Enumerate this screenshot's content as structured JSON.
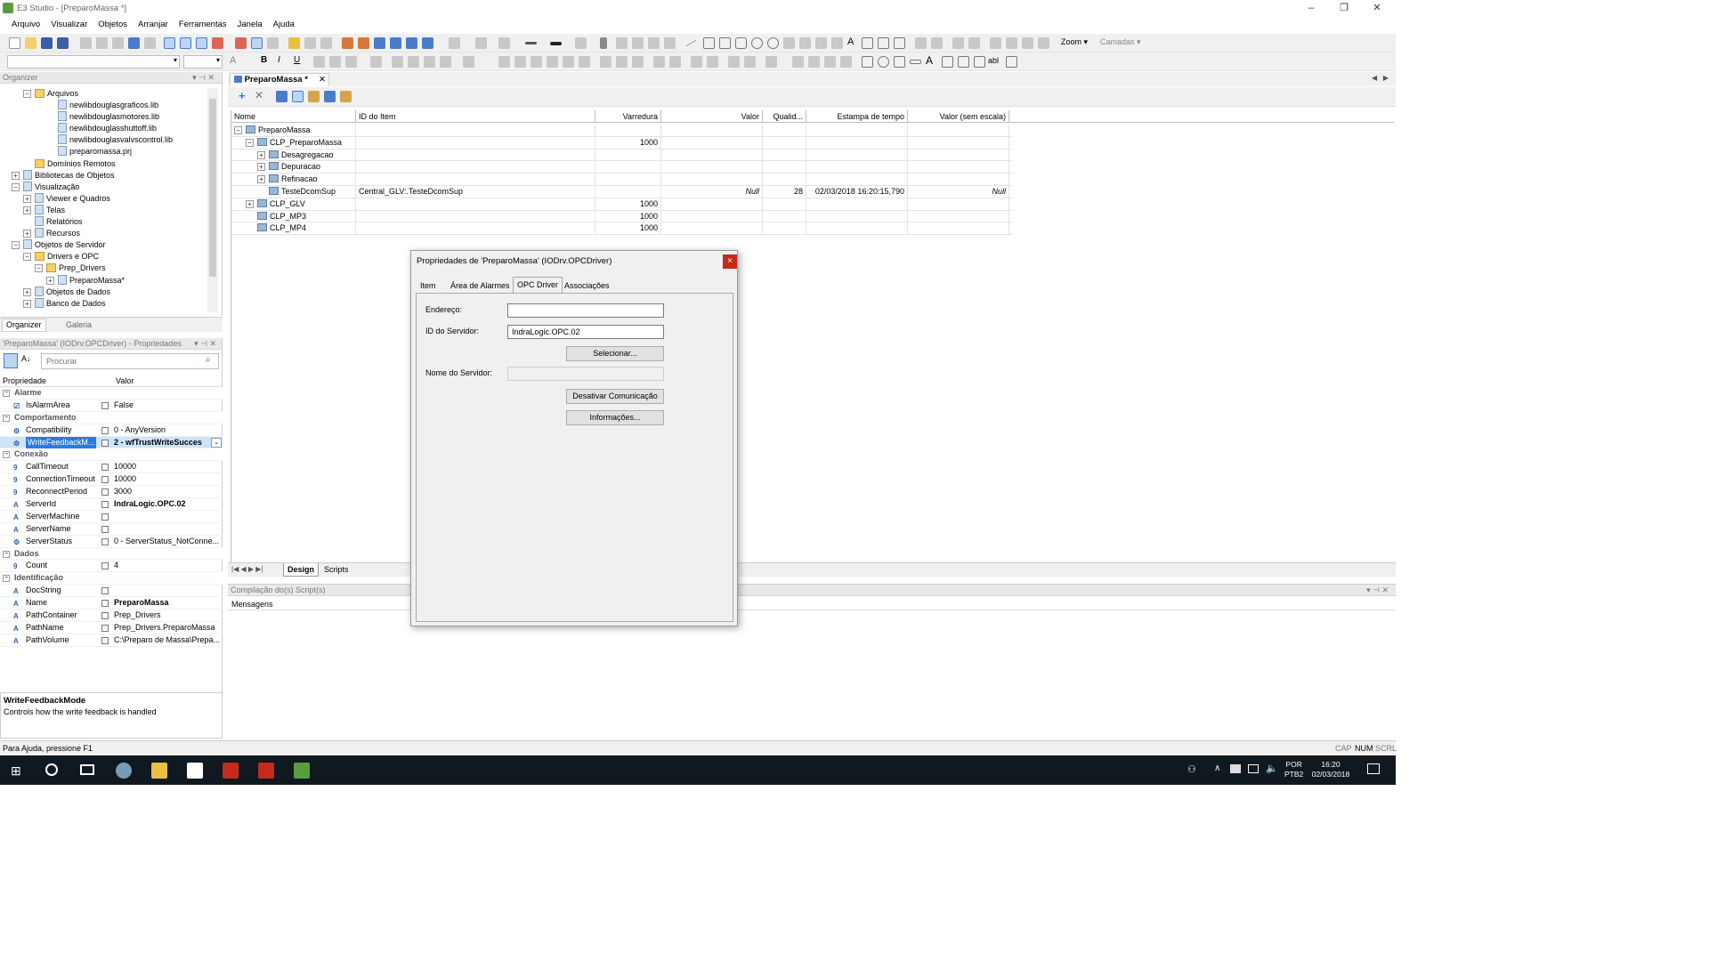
{
  "window": {
    "title": "E3 Studio - [PreparoMassa *]"
  },
  "menu": [
    "Arquivo",
    "Visualizar",
    "Objetos",
    "Arranjar",
    "Ferramentas",
    "Janela",
    "Ajuda"
  ],
  "toolbar": {
    "zoom_label": "Zoom",
    "layers_label": "Camadas"
  },
  "organizer": {
    "header": "Organizer",
    "tree": [
      {
        "label": "Arquivos",
        "indent": 3,
        "type": "folder",
        "exp": "-"
      },
      {
        "label": "newlibdouglasgraficos.lib",
        "indent": 5,
        "type": "file"
      },
      {
        "label": "newlibdouglasmotores.lib",
        "indent": 5,
        "type": "file"
      },
      {
        "label": "newlibdouglasshuttoff.lib",
        "indent": 5,
        "type": "file"
      },
      {
        "label": "newlibdouglasvalvscontrol.lib",
        "indent": 5,
        "type": "file"
      },
      {
        "label": "preparomassa.prj",
        "indent": 5,
        "type": "file"
      },
      {
        "label": "Domínios Remotos",
        "indent": 3,
        "type": "folder"
      },
      {
        "label": "Bibliotecas de Objetos",
        "indent": 2,
        "type": "file",
        "exp": "+"
      },
      {
        "label": "Visualização",
        "indent": 2,
        "type": "file",
        "exp": "-"
      },
      {
        "label": "Viewer e Quadros",
        "indent": 3,
        "type": "file",
        "exp": "+"
      },
      {
        "label": "Telas",
        "indent": 3,
        "type": "file",
        "exp": "+"
      },
      {
        "label": "Relatórios",
        "indent": 3,
        "type": "file"
      },
      {
        "label": "Recursos",
        "indent": 3,
        "type": "file",
        "exp": "+"
      },
      {
        "label": "Objetos de Servidor",
        "indent": 2,
        "type": "file",
        "exp": "-"
      },
      {
        "label": "Drivers e OPC",
        "indent": 3,
        "type": "folder",
        "exp": "-"
      },
      {
        "label": "Prep_Drivers",
        "indent": 4,
        "type": "folder",
        "exp": "-"
      },
      {
        "label": "PreparoMassa*",
        "indent": 5,
        "type": "file",
        "exp": "+"
      },
      {
        "label": "Objetos de Dados",
        "indent": 3,
        "type": "file",
        "exp": "+"
      },
      {
        "label": "Banco de Dados",
        "indent": 3,
        "type": "file",
        "exp": "+"
      }
    ],
    "tabs": [
      "Organizer",
      "Galeria"
    ]
  },
  "properties": {
    "header": "'PreparoMassa' (IODrv.OPCDriver) - Propriedades",
    "search_placeholder": "Procurar",
    "col_prop": "Propriedade",
    "col_value": "Valor",
    "rows": [
      {
        "cat": "Alarme"
      },
      {
        "name": "IsAlarmArea",
        "value": "False",
        "icon": "☑"
      },
      {
        "cat": "Comportamento"
      },
      {
        "name": "Compatibility",
        "value": "0 - AnyVersion",
        "icon": "⚙"
      },
      {
        "name": "WriteFeedbackM...",
        "value": "2 - wfTrustWriteSucces",
        "icon": "⚙",
        "bold": true,
        "selected": true
      },
      {
        "cat": "Conexão"
      },
      {
        "name": "CallTimeout",
        "value": "10000",
        "icon": "9"
      },
      {
        "name": "ConnectionTimeout",
        "value": "10000",
        "icon": "9"
      },
      {
        "name": "ReconnectPeriod",
        "value": "3000",
        "icon": "9"
      },
      {
        "name": "ServerId",
        "value": "IndraLogic.OPC.02",
        "icon": "A",
        "bold": true
      },
      {
        "name": "ServerMachine",
        "value": "",
        "icon": "A"
      },
      {
        "name": "ServerName",
        "value": "",
        "icon": "A"
      },
      {
        "name": "ServerStatus",
        "value": "0 - ServerStatus_NotConne...",
        "icon": "⚙"
      },
      {
        "cat": "Dados"
      },
      {
        "name": "Count",
        "value": "4",
        "icon": "9"
      },
      {
        "cat": "Identificação"
      },
      {
        "name": "DocString",
        "value": "",
        "icon": "A"
      },
      {
        "name": "Name",
        "value": "PreparoMassa",
        "icon": "A",
        "bold": true
      },
      {
        "name": "PathContainer",
        "value": "Prep_Drivers",
        "icon": "A"
      },
      {
        "name": "PathName",
        "value": "Prep_Drivers.PreparoMassa",
        "icon": "A"
      },
      {
        "name": "PathVolume",
        "value": "C:\\Preparo de Massa\\Prepa...",
        "icon": "A"
      }
    ],
    "help_title": "WriteFeedbackMode",
    "help_text": "Controls how the write feedback is handled"
  },
  "document": {
    "tab_title": "PreparoMassa *",
    "columns": [
      "Nome",
      "ID do Item",
      "Varredura",
      "Valor",
      "Qualid...",
      "Estampa de tempo",
      "Valor (sem escala)"
    ],
    "rows": [
      {
        "name": "PreparoMassa",
        "item": "",
        "scan": "",
        "value": "",
        "quality": "",
        "timestamp": "",
        "raw": "",
        "indent": 0,
        "exp": "-"
      },
      {
        "name": "CLP_PreparoMassa",
        "item": "",
        "scan": "1000",
        "value": "",
        "quality": "",
        "timestamp": "",
        "raw": "",
        "indent": 1,
        "exp": "-"
      },
      {
        "name": "Desagregacao",
        "item": "",
        "scan": "",
        "value": "",
        "quality": "",
        "timestamp": "",
        "raw": "",
        "indent": 2,
        "exp": "+"
      },
      {
        "name": "Depuracao",
        "item": "",
        "scan": "",
        "value": "",
        "quality": "",
        "timestamp": "",
        "raw": "",
        "indent": 2,
        "exp": "+"
      },
      {
        "name": "Refinacao",
        "item": "",
        "scan": "",
        "value": "",
        "quality": "",
        "timestamp": "",
        "raw": "",
        "indent": 2,
        "exp": "+"
      },
      {
        "name": "TesteDcomSup",
        "item": "Central_GLV:.TesteDcomSup",
        "scan": "",
        "value": "Null",
        "quality": "28",
        "timestamp": "02/03/2018 16:20:15,790",
        "raw": "Null",
        "indent": 2
      },
      {
        "name": "CLP_GLV",
        "item": "",
        "scan": "1000",
        "value": "",
        "quality": "",
        "timestamp": "",
        "raw": "",
        "indent": 1,
        "exp": "+"
      },
      {
        "name": "CLP_MP3",
        "item": "",
        "scan": "1000",
        "value": "",
        "quality": "",
        "timestamp": "",
        "raw": "",
        "indent": 1
      },
      {
        "name": "CLP_MP4",
        "item": "",
        "scan": "1000",
        "value": "",
        "quality": "",
        "timestamp": "",
        "raw": "",
        "indent": 1
      }
    ],
    "bottom_tabs": [
      "Design",
      "Scripts"
    ]
  },
  "dialog": {
    "title": "Propriedades de 'PreparoMassa' (IODrv.OPCDriver)",
    "tabs": [
      "Item",
      "Área de Alarmes",
      "OPC Driver",
      "Associações"
    ],
    "address_label": "Endereço:",
    "address_value": "",
    "server_id_label": "ID do Servidor:",
    "server_id_value": "IndraLogic.OPC.02",
    "select_button": "Selecionar...",
    "server_name_label": "Nome do Servidor:",
    "server_name_value": "",
    "disable_button": "Desativar Comunicação",
    "info_button": "Informações...",
    "close_symbol": "×"
  },
  "compile": {
    "header": "Compilação do(s) Script(s)",
    "col": "Mensagens"
  },
  "status": {
    "help": "Para Ajuda, pressione F1",
    "indicators": [
      "CAP",
      "NUM",
      "SCRL"
    ]
  },
  "taskbar": {
    "lang1": "POR",
    "lang2": "PTB2",
    "time": "16:20",
    "date": "02/03/2018"
  }
}
